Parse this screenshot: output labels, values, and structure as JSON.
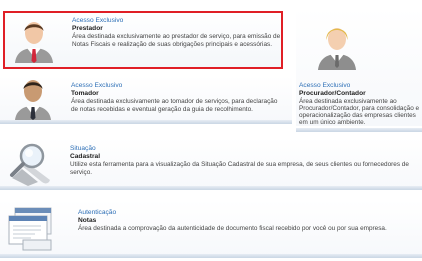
{
  "cards": {
    "prestador": {
      "kicker": "Acesso Exclusivo",
      "title": "Prestador",
      "desc_line1": "Área destinada exclusivamente ao prestador de serviço, para emissão de",
      "desc_line2": "Notas Fiscais e realização de suas obrigações principais e acessórias."
    },
    "tomador": {
      "kicker": "Acesso Exclusivo",
      "title": "Tomador",
      "desc_line1": "Área destinada exclusivamente ao tomador de serviços, para declaração",
      "desc_line2": "de notas recebidas e eventual geração da guia de recolhimento."
    },
    "procurador": {
      "kicker": "Acesso Exclusivo",
      "title": "Procurador/Contador",
      "desc_lines": [
        "Área destinada exclusivamente ao",
        "Procurador/Contador, para consolidação e",
        "operacionalização das empresas clientes",
        "em um único ambiente."
      ]
    },
    "situacao": {
      "kicker": "Situação",
      "title": "Cadastral",
      "desc_line1": "Utilize esta ferramenta para a visualização da Situação Cadastral de sua empresa, de seus clientes ou fornecedores de",
      "desc_line2": "serviço."
    },
    "autenticacao": {
      "kicker": "Autenticação",
      "title": "Notas",
      "desc_line1": "Área destinada a comprovação da autenticidade de documento fiscal recebido por você ou por sua empresa."
    }
  },
  "icons": {
    "prestador": "businessman-red-tie-icon",
    "tomador": "businessman-dark-tie-icon",
    "procurador": "blonde-person-icon",
    "situacao": "magnifier-icon",
    "autenticacao": "documents-icon"
  },
  "colors": {
    "highlight_border": "#e01f26",
    "kicker_blue": "#2d6fb6"
  }
}
